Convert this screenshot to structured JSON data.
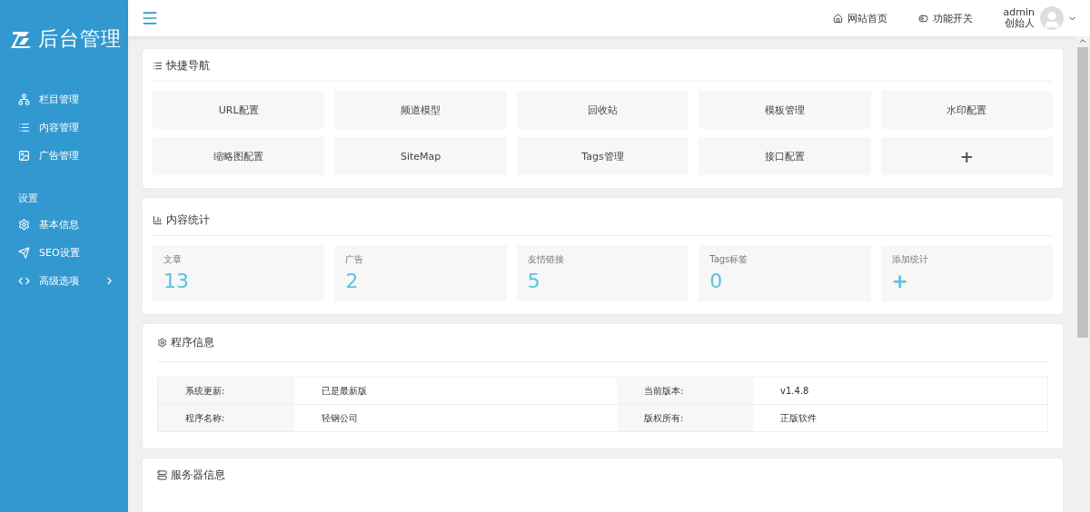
{
  "sidebar": {
    "brand": "后台管理",
    "groups": [
      {
        "items": [
          {
            "label": "栏目管理",
            "has_submenu": false
          },
          {
            "label": "内容管理",
            "has_submenu": false
          },
          {
            "label": "广告管理",
            "has_submenu": false
          }
        ]
      },
      {
        "heading": "设置",
        "items": [
          {
            "label": "基本信息",
            "has_submenu": false
          },
          {
            "label": "SEO设置",
            "has_submenu": false
          },
          {
            "label": "高级选项",
            "has_submenu": true
          }
        ]
      }
    ]
  },
  "header": {
    "links": [
      {
        "label": "网站首页"
      },
      {
        "label": "功能开关"
      }
    ],
    "user": {
      "name": "admin",
      "role": "创始人"
    }
  },
  "quick_nav": {
    "title": "快捷导航",
    "items": [
      {
        "kind": "link",
        "label": "URL配置"
      },
      {
        "kind": "link",
        "label": "频道模型"
      },
      {
        "kind": "link",
        "label": "回收站"
      },
      {
        "kind": "link",
        "label": "模板管理"
      },
      {
        "kind": "link",
        "label": "水印配置"
      },
      {
        "kind": "link",
        "label": "缩略图配置"
      },
      {
        "kind": "link",
        "label": "SiteMap"
      },
      {
        "kind": "link",
        "label": "Tags管理"
      },
      {
        "kind": "link",
        "label": "接口配置"
      },
      {
        "kind": "add",
        "label": "+"
      }
    ]
  },
  "stats": {
    "title": "内容统计",
    "items": [
      {
        "label": "文章",
        "value": "13"
      },
      {
        "label": "广告",
        "value": "2"
      },
      {
        "label": "友情链接",
        "value": "5"
      },
      {
        "label": "Tags标签",
        "value": "0"
      },
      {
        "label": "添加统计",
        "value": "+"
      }
    ]
  },
  "program_info": {
    "title": "程序信息",
    "rows": [
      [
        {
          "label": "系统更新:",
          "value": "已是最新版"
        },
        {
          "label": "当前版本:",
          "value": "v1.4.8"
        }
      ],
      [
        {
          "label": "程序名称:",
          "value": "轻钢公司"
        },
        {
          "label": "版权所有:",
          "value": "正版软件"
        }
      ]
    ]
  },
  "server_info": {
    "title": "服务器信息"
  }
}
